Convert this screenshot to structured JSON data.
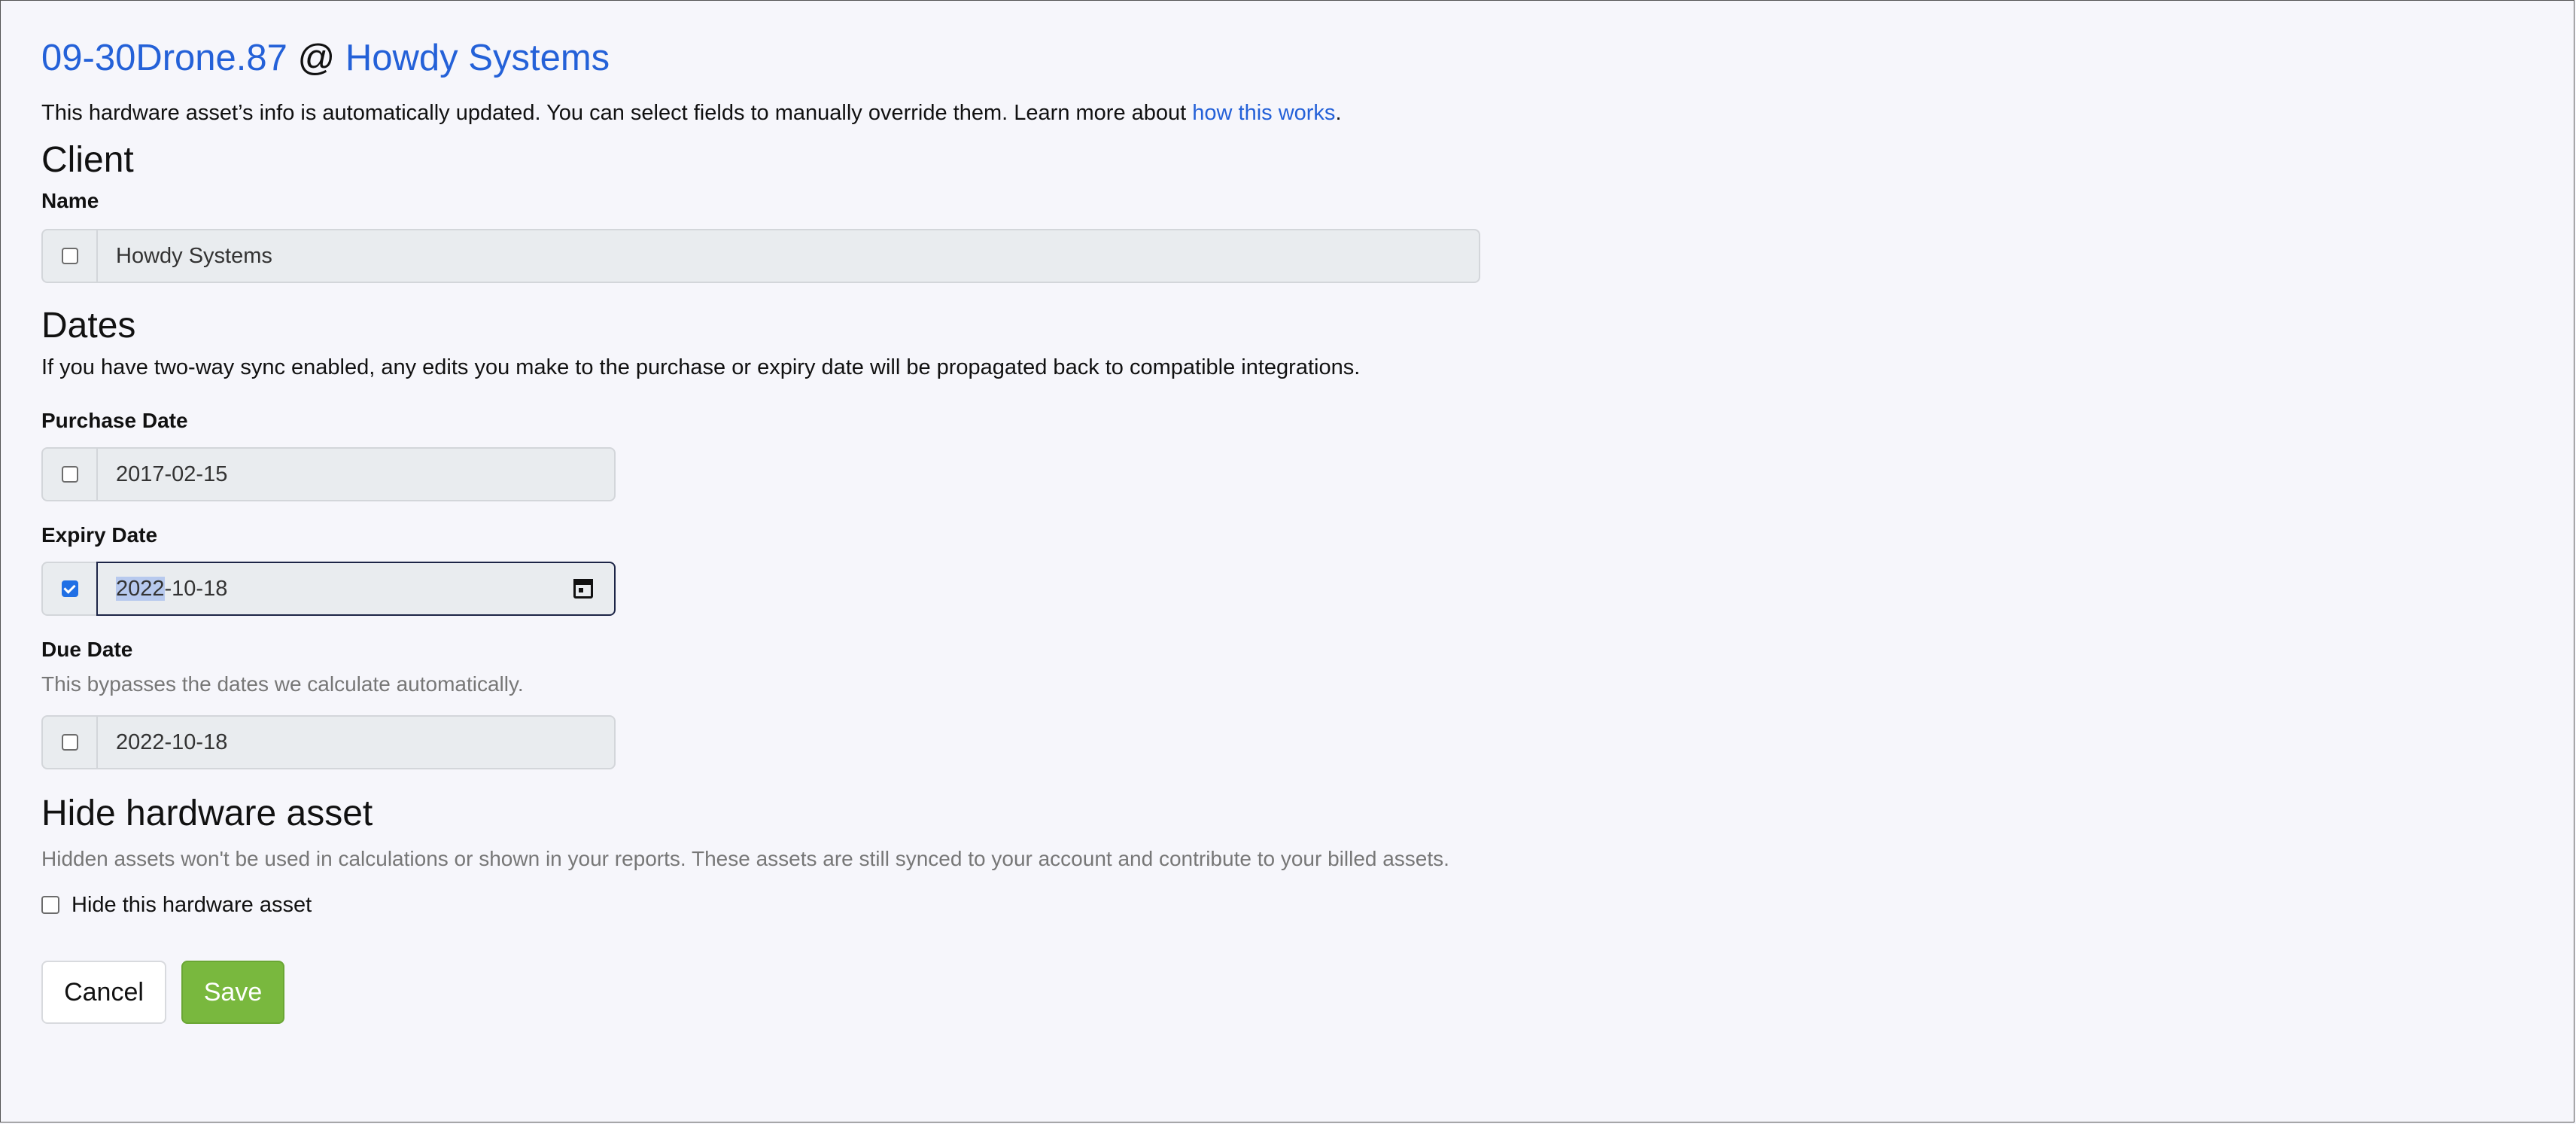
{
  "header": {
    "asset_name": "09-30Drone.87",
    "at": "@",
    "client_link": "Howdy Systems"
  },
  "intro": {
    "text": "This hardware asset’s info is automatically updated. You can select fields to manually override them. Learn more about ",
    "link": "how this works",
    "suffix": "."
  },
  "client_section": {
    "heading": "Client",
    "name_label": "Name",
    "name_value": "Howdy Systems",
    "name_override_checked": false
  },
  "dates_section": {
    "heading": "Dates",
    "description": "If you have two-way sync enabled, any edits you make to the purchase or expiry date will be propagated back to compatible integrations.",
    "purchase_label": "Purchase Date",
    "purchase_value": "2017-02-15",
    "purchase_override_checked": false,
    "expiry_label": "Expiry Date",
    "expiry_year": "2022",
    "expiry_rest": "-10-18",
    "expiry_override_checked": true,
    "due_label": "Due Date",
    "due_help": "This bypasses the dates we calculate automatically.",
    "due_value": "2022-10-18",
    "due_override_checked": false
  },
  "hide_section": {
    "heading": "Hide hardware asset",
    "help": "Hidden assets won't be used in calculations or shown in your reports. These assets are still synced to your account and contribute to your billed assets.",
    "checkbox_label": "Hide this hardware asset",
    "checked": false
  },
  "actions": {
    "cancel_label": "Cancel",
    "save_label": "Save"
  },
  "colors": {
    "link": "#2461d8",
    "save": "#79b83e",
    "checkbox_checked": "#1f6fe5"
  },
  "icons": {
    "calendar": "calendar-icon"
  }
}
